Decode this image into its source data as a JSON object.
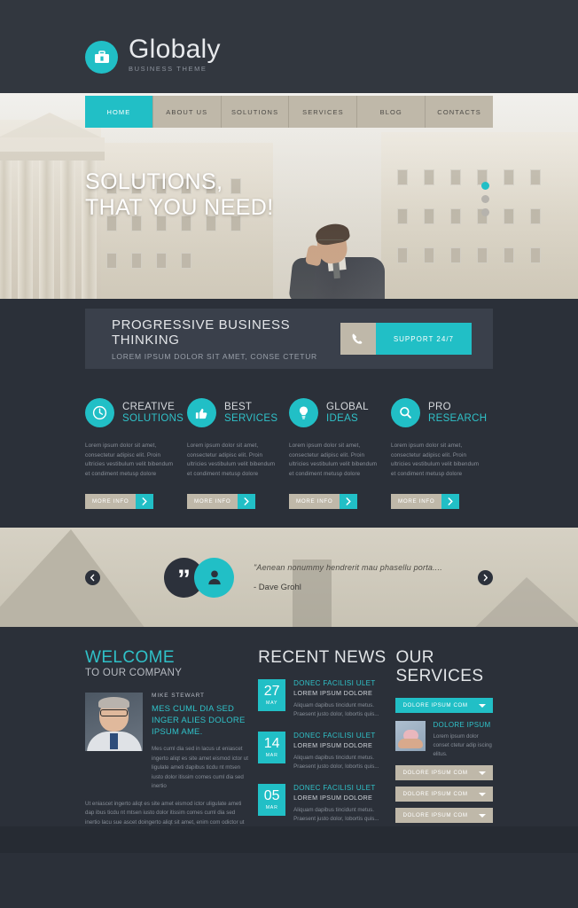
{
  "colors": {
    "accent": "#21bfc6",
    "dark": "#2b3039",
    "panel": "#3a404b",
    "beige": "#bfb8a9"
  },
  "header": {
    "logo_title": "Globaly",
    "logo_sub": "BUSINESS THEME",
    "logo_icon": "briefcase-icon"
  },
  "nav": {
    "items": [
      {
        "label": "HOME",
        "active": true
      },
      {
        "label": "ABOUT US",
        "active": false
      },
      {
        "label": "SOLUTIONS",
        "active": false
      },
      {
        "label": "SERVICES",
        "active": false
      },
      {
        "label": "BLOG",
        "active": false
      },
      {
        "label": "CONTACTS",
        "active": false
      }
    ]
  },
  "hero": {
    "title_line1": "SOLUTIONS,",
    "title_line2": "THAT YOU NEED!",
    "slider_dots": 3,
    "active_dot": 1
  },
  "callout": {
    "title": "PROGRESSIVE BUSINESS THINKING",
    "subtitle": "LOREM IPSUM DOLOR SIT AMET, CONSE CTETUR",
    "button_label": "SUPPORT 24/7",
    "button_icon": "phone-icon"
  },
  "services": {
    "items": [
      {
        "icon": "clock-icon",
        "title_line1": "CREATIVE",
        "title_line2": "SOLUTIONS",
        "body": "Lorem ipsum dolor sit amet, consectetur adipisc elit. Proin ultricies vestibulum velit bibendum et condiment metusp dolore",
        "button_label": "MORE INFO"
      },
      {
        "icon": "thumbs-up-icon",
        "title_line1": "BEST",
        "title_line2": "SERVICES",
        "body": "Lorem ipsum dolor sit amet, consectetur adipisc elit. Proin ultricies vestibulum velit bibendum et condiment metusp dolore",
        "button_label": "MORE INFO"
      },
      {
        "icon": "lightbulb-icon",
        "title_line1": "GLOBAL",
        "title_line2": "IDEAS",
        "body": "Lorem ipsum dolor sit amet, consectetur adipisc elit. Proin ultricies vestibulum velit bibendum et condiment metusp dolore",
        "button_label": "MORE INFO"
      },
      {
        "icon": "magnifier-icon",
        "title_line1": "PRO",
        "title_line2": "RESEARCH",
        "body": "Lorem ipsum dolor sit amet, consectetur adipisc elit. Proin ultricies vestibulum velit bibendum et condiment metusp dolore",
        "button_label": "MORE INFO"
      }
    ]
  },
  "testimonial": {
    "quote": "\"Aenean nonummy hendrerit mau phasellu porta....",
    "author": "- Dave Grohl",
    "prev_icon": "arrow-left-icon",
    "next_icon": "arrow-right-icon",
    "quote_icon": "quote-icon",
    "person_icon": "person-icon"
  },
  "welcome": {
    "title": "WELCOME",
    "subtitle": "TO OUR COMPANY",
    "person_name": "MIKE STEWART",
    "heading": "MES CUML DIA SED INGER ALIES DOLORE IPSUM AME.",
    "paragraph1": "Mes cuml dia sed in lacus ut eniascet ingerto aliqt es site amet eismod ictor ut ligulate ameti dapibus ticdu nt mtsen iusto dolor itissim comes cuml dia sed inertio",
    "paragraph2": "Ut eniascet ingerto aliqt es site amet eismod ictor uligulate ameti dap ibus ticdu nt mtsen iusto dolor itissim comes cuml dia sed inertio lacu sue ascet doingerto aliqt sit amet, enim com odictor ut ligulate ameti dapibu. Nemo enim ipsam voluptatem voluptas sit aspernatur odit aut fugit sed quia con sequuntur magni dolores eos qui ratione."
  },
  "news": {
    "title": "RECENT NEWS",
    "items": [
      {
        "day": "27",
        "month": "MAY",
        "title": "DONEC FACILISI ULET",
        "subtitle": "LOREM IPSUM DOLORE",
        "body": "Aliquam dapibus tincidunt metus. Praesent justo dolor, lobortis quis..."
      },
      {
        "day": "14",
        "month": "MAR",
        "title": "DONEC FACILISI ULET",
        "subtitle": "LOREM IPSUM DOLORE",
        "body": "Aliquam dapibus tincidunt metus. Praesent justo dolor, lobortis quis..."
      },
      {
        "day": "05",
        "month": "MAR",
        "title": "DONEC FACILISI ULET",
        "subtitle": "LOREM IPSUM DOLORE",
        "body": "Aliquam dapibus tincidunt metus. Praesent justo dolor, lobortis quis..."
      }
    ]
  },
  "our_services": {
    "title": "OUR SERVICES",
    "open_item": "DOLORE IPSUM COM",
    "panel": {
      "heading": "DOLORE IPSUM",
      "body": "Lorem ipsum dolor conset ctetur adip iscing elitus.",
      "thumb": "piggy-bank-image"
    },
    "closed_items": [
      "DOLORE IPSUM COM",
      "DOLORE IPSUM COM",
      "DOLORE IPSUM COM"
    ]
  }
}
